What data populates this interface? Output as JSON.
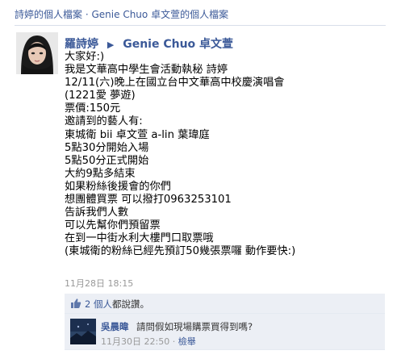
{
  "breadcrumb": {
    "owner_link": "詩婷的個人檔案",
    "separator": "·",
    "target_link": "Genie Chuo 卓文萱的個人檔案"
  },
  "post": {
    "author": "羅詩婷",
    "arrow": "▶",
    "recipient": "Genie Chuo 卓文萱",
    "message_lines": [
      "大家好:)",
      "我是文華高中學生會活動執秘 詩婷",
      "12/11(六)晚上在國立台中文華高中校慶演唱會",
      "(1221愛 夢遊)",
      "票價:150元",
      "邀請到的藝人有:",
      "東城衛 bii 卓文萱 a-lin 葉瑋庭",
      "5點30分開始入場",
      "5點50分正式開始",
      "大約9點多結束",
      "如果粉絲後援會的你們",
      "想團體買票 可以撥打0963253101",
      "告訴我們人數",
      "可以先幫你們預留票",
      "在到一中街水利大樓門口取票哦",
      "(東城衛的粉絲已經先預訂50幾張票囉 動作要快:)"
    ],
    "timestamp": "11月28日 18:15"
  },
  "likes": {
    "count_link": "2 個人",
    "suffix": "都說讚。"
  },
  "comment": {
    "author": "吳晨暐",
    "text": "請問假如現場購票買得到嗎?",
    "timestamp": "11月30日 22:50",
    "separator": "·",
    "action": "檢舉"
  },
  "colors": {
    "link": "#3b5998",
    "feedback_bg": "#eceff5",
    "meta_gray": "#999999"
  }
}
